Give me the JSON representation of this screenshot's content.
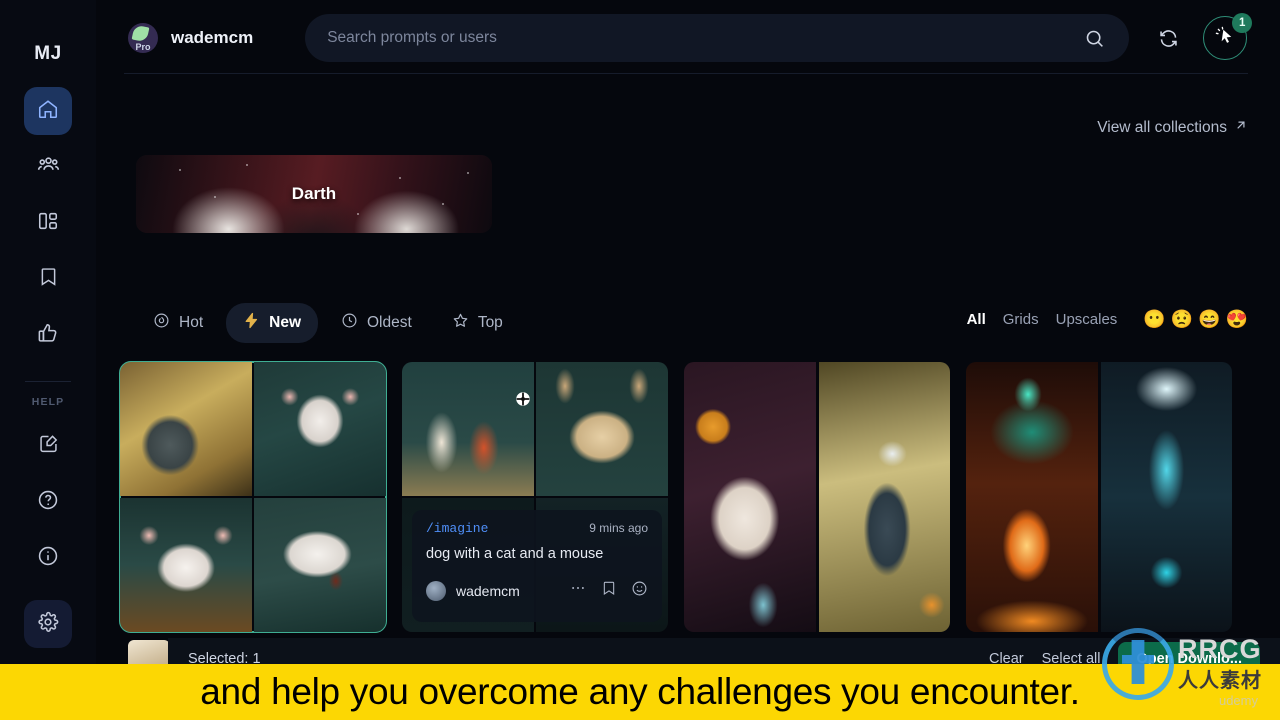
{
  "sidebar": {
    "brand": "MJ",
    "items": [
      {
        "name": "home",
        "icon": "home-icon",
        "active": true
      },
      {
        "name": "community",
        "icon": "people-icon",
        "active": false
      },
      {
        "name": "layout",
        "icon": "layout-grid-icon",
        "active": false
      },
      {
        "name": "saved",
        "icon": "bookmark-icon",
        "active": false
      },
      {
        "name": "likes",
        "icon": "thumbs-up-icon",
        "active": false
      }
    ],
    "help_label": "HELP",
    "help_items": [
      {
        "name": "feedback",
        "icon": "edit-square-icon"
      },
      {
        "name": "faq",
        "icon": "question-circle-icon"
      },
      {
        "name": "about",
        "icon": "info-circle-icon"
      }
    ],
    "settings": {
      "name": "settings",
      "icon": "gear-icon",
      "active": true
    }
  },
  "topbar": {
    "user_name": "wademcm",
    "avatar_label": "Pro",
    "search_placeholder": "Search prompts or users",
    "search_value": "",
    "search_icon": "search-icon",
    "refresh_icon": "refresh-icon",
    "cursor_icon": "cursor-click-icon",
    "badge_count": "1"
  },
  "collections": {
    "view_all_label": "View all collections",
    "view_all_icon": "arrow-up-right-icon",
    "cards": [
      {
        "title": "Darth"
      }
    ]
  },
  "sort_tabs": [
    {
      "label": "Hot",
      "icon": "flame-icon",
      "active": false
    },
    {
      "label": "New",
      "icon": "bolt-icon",
      "active": true
    },
    {
      "label": "Oldest",
      "icon": "clock-icon",
      "active": false
    },
    {
      "label": "Top",
      "icon": "star-icon",
      "active": false
    }
  ],
  "filters": [
    {
      "label": "All",
      "active": true
    },
    {
      "label": "Grids",
      "active": false
    },
    {
      "label": "Upscales",
      "active": false
    }
  ],
  "emoji_filters": [
    {
      "name": "neutral-face-emoji",
      "glyph": "😶"
    },
    {
      "name": "frowning-face-emoji",
      "glyph": "😟"
    },
    {
      "name": "grinning-face-emoji",
      "glyph": "😄"
    },
    {
      "name": "heart-eyes-emoji",
      "glyph": "😍"
    }
  ],
  "gallery": {
    "tiles": [
      {
        "name": "mouse-grid",
        "layout": "quad",
        "selected": true
      },
      {
        "name": "cat-dog-grid",
        "layout": "quad",
        "selected": false
      },
      {
        "name": "dog-portraits",
        "layout": "duo",
        "selected": false
      },
      {
        "name": "fire-ice-gates",
        "layout": "duo",
        "selected": false
      }
    ]
  },
  "info_card": {
    "command": "/imagine",
    "time": "9 mins ago",
    "prompt": "dog with a cat and a mouse",
    "user": "wademcm",
    "more_icon": "more-horizontal-icon",
    "bookmark_icon": "bookmark-icon",
    "emoji_icon": "smiley-icon"
  },
  "selection_bar": {
    "selected_label": "Selected: 1",
    "clear_label": "Clear",
    "select_all_label": "Select all",
    "open_label": "Open Downlo..."
  },
  "subtitle": {
    "text": "and help you overcome any challenges you encounter."
  },
  "watermark": {
    "brand": "RRCG",
    "cn": "人人素材",
    "platform": "udemy"
  },
  "colors": {
    "accent_blue": "#8fb4ff",
    "accent_teal": "#3fae93",
    "accent_green": "#1f7a5c",
    "bolt_gold": "#e3b24a",
    "subtitle_yellow": "#fcd703",
    "background": "#05070d"
  }
}
